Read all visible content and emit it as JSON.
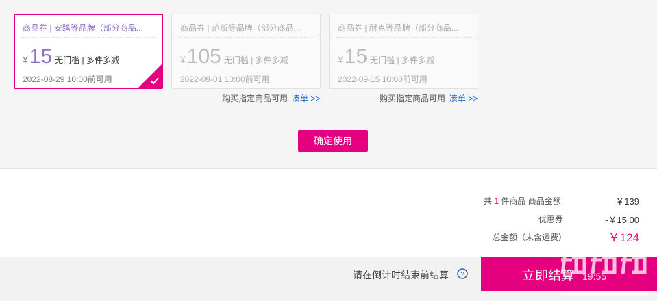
{
  "coupons": [
    {
      "title": "商品券 | 安踏等品牌（部分商品...",
      "currency": "¥",
      "amount": "15",
      "desc": "无门槛 | 多件多减",
      "date": "2022-08-29 10:00前可用",
      "selected": true
    },
    {
      "title": "商品券 | 范斯等品牌（部分商品...",
      "currency": "¥",
      "amount": "105",
      "desc": "无门槛 | 多件多减",
      "date": "2022-09-01 10:00前可用",
      "selected": false
    },
    {
      "title": "商品券 | 耐克等品牌（部分商品...",
      "currency": "¥",
      "amount": "15",
      "desc": "无门槛 | 多件多减",
      "date": "2022-09-15 10:00前可用",
      "selected": false
    }
  ],
  "coupon_notes": [
    {
      "text": "购买指定商品可用",
      "link": "凑单 >>"
    },
    {
      "text": "购买指定商品可用",
      "link": "凑单 >>"
    }
  ],
  "confirm_button": "确定使用",
  "summary": {
    "count_prefix": "共",
    "count": "1",
    "count_suffix": "件商品  商品金额",
    "subtotal": "￥139",
    "discount_label": "优惠券",
    "discount": "-￥15.00",
    "total_label": "总金额（未含运费）",
    "total": "￥124"
  },
  "bottom": {
    "countdown_text": "请在倒计时结束前结算",
    "checkout_label": "立即结算",
    "timer": "19:55"
  },
  "colors": {
    "accent": "#e5007f",
    "coupon_selected_text": "#8e6fbf",
    "link": "#1a66cc"
  },
  "icons": [
    "check-corner-icon",
    "help-circle-icon"
  ]
}
